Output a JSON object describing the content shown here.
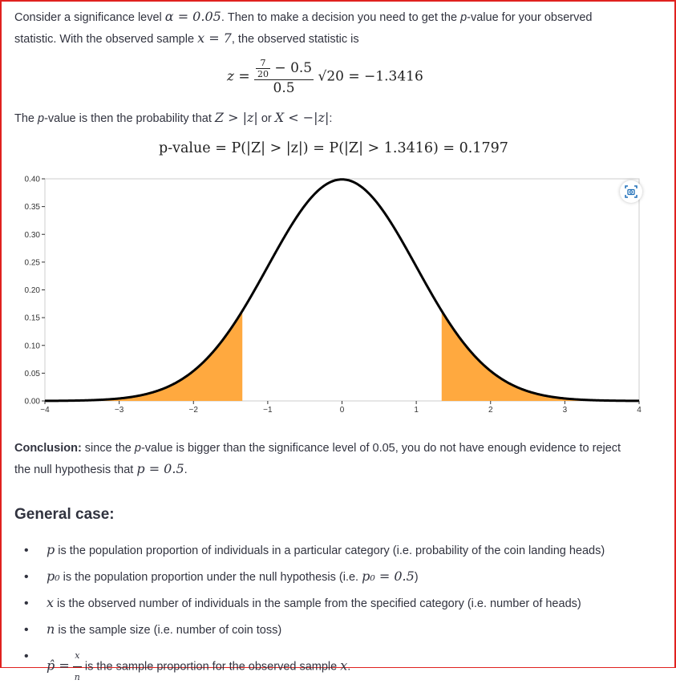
{
  "intro": {
    "t1": "Consider a significance level ",
    "alpha": "α = 0.05",
    "t2": ". Then to make a decision you need to get the ",
    "pvalue_word": "p",
    "t3": "-value for your observed",
    "t4": "statistic. With the observed sample ",
    "x_eq": "x = 7",
    "t5": ", the observed statistic is"
  },
  "z_equation": {
    "lhs": "z =",
    "frac_num": "7",
    "frac_den": "20",
    "minus_half": " − 0.5",
    "den": "0.5",
    "sqrt": "√20",
    "rhs": "= −1.3416"
  },
  "pvalue_text": {
    "t1": "The ",
    "p": "p",
    "t2": "-value is then the probability that ",
    "cond1": "Z > |z|",
    "or": " or ",
    "cond2": "X < −|z|",
    "t3": ":"
  },
  "pvalue_equation": "p-value = P(|Z| > |z|) = P(|Z| > 1.3416) = 0.1797",
  "chart_data": {
    "type": "area",
    "curve": "standard normal density",
    "xlim": [
      -4,
      4
    ],
    "ylim": [
      0,
      0.4
    ],
    "xticks": [
      "−4",
      "−3",
      "−2",
      "−1",
      "0",
      "1",
      "2",
      "3",
      "4"
    ],
    "yticks": [
      "0.00",
      "0.05",
      "0.10",
      "0.15",
      "0.20",
      "0.25",
      "0.30",
      "0.35",
      "0.40"
    ],
    "shaded_regions": [
      [
        -4,
        -1.3416
      ],
      [
        1.3416,
        4
      ]
    ],
    "curve_color": "#000000",
    "fill_color": "#ffa93f",
    "grid": false
  },
  "camera_icon": "camera-icon",
  "conclusion": {
    "bold": "Conclusion:",
    "t1": " since the ",
    "p": "p",
    "t2": "-value is bigger than the significance level of 0.05, you do not have enough evidence to reject",
    "t3": "the null hypothesis that ",
    "peq": "p = 0.5",
    "t4": "."
  },
  "general_case": {
    "heading": "General case:",
    "items": [
      {
        "math": "p",
        "text": " is the population proportion of individuals in a particular category (i.e. probability of the coin landing heads)"
      },
      {
        "math": "p₀",
        "text": " is the population proportion under the null hypothesis (i.e. ",
        "math2": "p₀ = 0.5",
        "text2": ")"
      },
      {
        "math": "x",
        "text": " is the observed number of individuals in the sample from the specified category  (i.e. number of heads)"
      },
      {
        "math": "n",
        "text": " is the sample size (i.e. number of coin toss)"
      },
      {
        "math": "p̂ =",
        "frac_num": "x",
        "frac_den": "n",
        "text": " is the sample proportion for the observed sample ",
        "math2": "x",
        "text2": "."
      }
    ]
  }
}
